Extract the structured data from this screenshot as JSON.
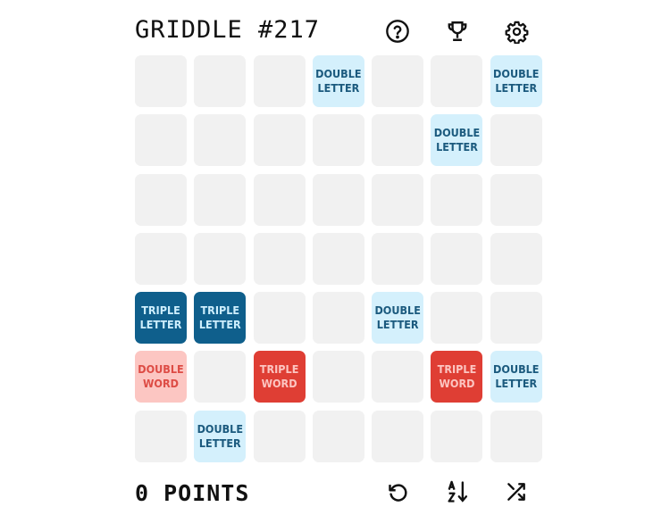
{
  "header": {
    "title": "GRIDDLE #217",
    "icons": [
      "help-icon",
      "trophy-icon",
      "settings-icon"
    ]
  },
  "board": {
    "rows": [
      [
        {
          "type": "empty",
          "line1": "",
          "line2": ""
        },
        {
          "type": "empty",
          "line1": "",
          "line2": ""
        },
        {
          "type": "empty",
          "line1": "",
          "line2": ""
        },
        {
          "type": "dl",
          "line1": "DOUBLE",
          "line2": "LETTER"
        },
        {
          "type": "empty",
          "line1": "",
          "line2": ""
        },
        {
          "type": "empty",
          "line1": "",
          "line2": ""
        },
        {
          "type": "dl",
          "line1": "DOUBLE",
          "line2": "LETTER"
        }
      ],
      [
        {
          "type": "empty",
          "line1": "",
          "line2": ""
        },
        {
          "type": "empty",
          "line1": "",
          "line2": ""
        },
        {
          "type": "empty",
          "line1": "",
          "line2": ""
        },
        {
          "type": "empty",
          "line1": "",
          "line2": ""
        },
        {
          "type": "empty",
          "line1": "",
          "line2": ""
        },
        {
          "type": "dl",
          "line1": "DOUBLE",
          "line2": "LETTER"
        },
        {
          "type": "empty",
          "line1": "",
          "line2": ""
        }
      ],
      [
        {
          "type": "empty",
          "line1": "",
          "line2": ""
        },
        {
          "type": "empty",
          "line1": "",
          "line2": ""
        },
        {
          "type": "empty",
          "line1": "",
          "line2": ""
        },
        {
          "type": "empty",
          "line1": "",
          "line2": ""
        },
        {
          "type": "empty",
          "line1": "",
          "line2": ""
        },
        {
          "type": "empty",
          "line1": "",
          "line2": ""
        },
        {
          "type": "empty",
          "line1": "",
          "line2": ""
        }
      ],
      [
        {
          "type": "empty",
          "line1": "",
          "line2": ""
        },
        {
          "type": "empty",
          "line1": "",
          "line2": ""
        },
        {
          "type": "empty",
          "line1": "",
          "line2": ""
        },
        {
          "type": "empty",
          "line1": "",
          "line2": ""
        },
        {
          "type": "empty",
          "line1": "",
          "line2": ""
        },
        {
          "type": "empty",
          "line1": "",
          "line2": ""
        },
        {
          "type": "empty",
          "line1": "",
          "line2": ""
        }
      ],
      [
        {
          "type": "tl",
          "line1": "TRIPLE",
          "line2": "LETTER"
        },
        {
          "type": "tl",
          "line1": "TRIPLE",
          "line2": "LETTER"
        },
        {
          "type": "empty",
          "line1": "",
          "line2": ""
        },
        {
          "type": "empty",
          "line1": "",
          "line2": ""
        },
        {
          "type": "dl",
          "line1": "DOUBLE",
          "line2": "LETTER"
        },
        {
          "type": "empty",
          "line1": "",
          "line2": ""
        },
        {
          "type": "empty",
          "line1": "",
          "line2": ""
        }
      ],
      [
        {
          "type": "dw",
          "line1": "DOUBLE",
          "line2": "WORD"
        },
        {
          "type": "empty",
          "line1": "",
          "line2": ""
        },
        {
          "type": "tw",
          "line1": "TRIPLE",
          "line2": "WORD"
        },
        {
          "type": "empty",
          "line1": "",
          "line2": ""
        },
        {
          "type": "empty",
          "line1": "",
          "line2": ""
        },
        {
          "type": "tw",
          "line1": "TRIPLE",
          "line2": "WORD"
        },
        {
          "type": "dl",
          "line1": "DOUBLE",
          "line2": "LETTER"
        }
      ],
      [
        {
          "type": "empty",
          "line1": "",
          "line2": ""
        },
        {
          "type": "dl",
          "line1": "DOUBLE",
          "line2": "LETTER"
        },
        {
          "type": "empty",
          "line1": "",
          "line2": ""
        },
        {
          "type": "empty",
          "line1": "",
          "line2": ""
        },
        {
          "type": "empty",
          "line1": "",
          "line2": ""
        },
        {
          "type": "empty",
          "line1": "",
          "line2": ""
        },
        {
          "type": "empty",
          "line1": "",
          "line2": ""
        }
      ]
    ]
  },
  "colors": {
    "double_letter_bg": "#d4f0fc",
    "triple_letter_bg": "#0f5f8c",
    "double_word_bg": "#fcc6c2",
    "triple_word_bg": "#df3e34",
    "empty_bg": "#f1f1f1"
  },
  "footer": {
    "points_label": "0 POINTS",
    "icons": [
      "reset-icon",
      "sort-alpha-icon",
      "shuffle-icon"
    ]
  }
}
